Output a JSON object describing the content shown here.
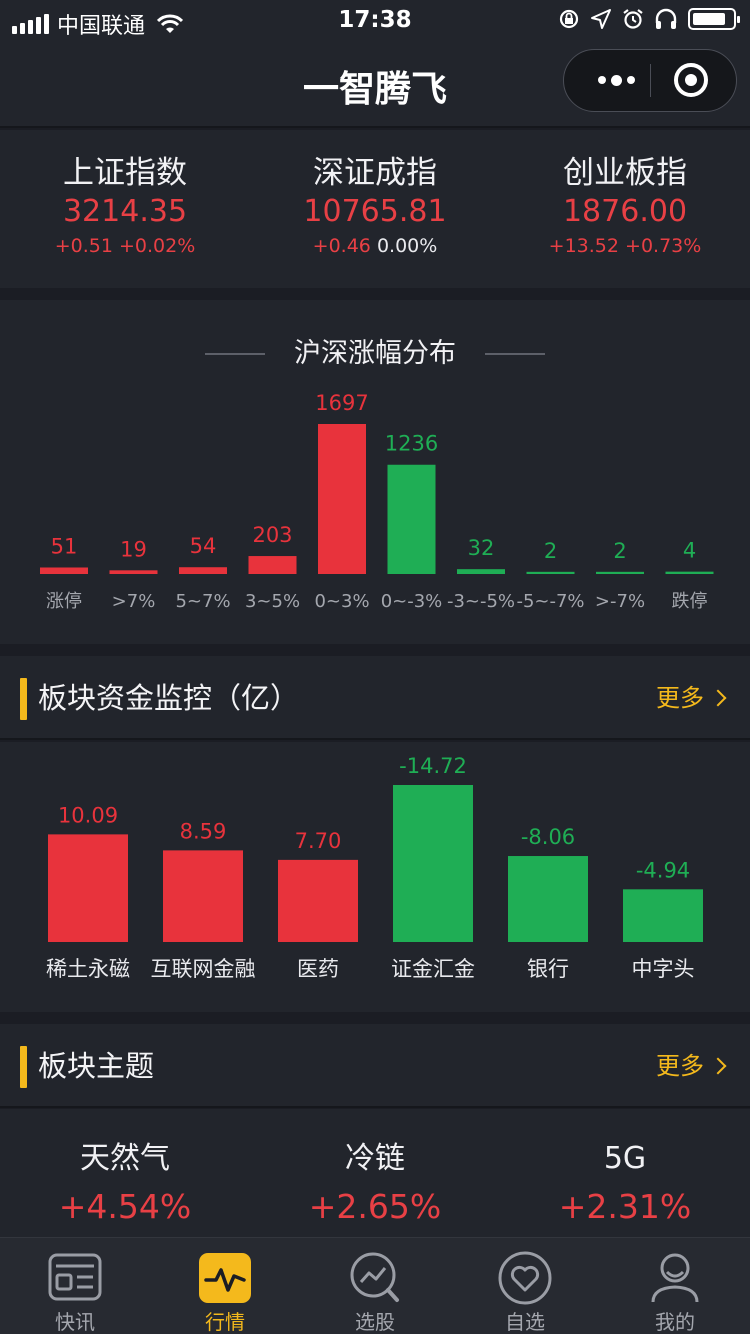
{
  "status_bar": {
    "carrier": "中国联通",
    "time": "17:38",
    "battery_level": 0.85,
    "icons": [
      "signal-icon",
      "wifi-icon",
      "rotation-lock-icon",
      "location-icon",
      "alarm-icon",
      "headphones-icon",
      "battery-icon"
    ]
  },
  "nav": {
    "title": "一智腾飞",
    "more_icon": "more-dots-icon",
    "close_icon": "target-icon"
  },
  "indices": [
    {
      "name": "上证指数",
      "value": "3214.35",
      "change": "+0.51",
      "percent": "+0.02%",
      "change_color": "red",
      "percent_color": "red"
    },
    {
      "name": "深证成指",
      "value": "10765.81",
      "change": "+0.46",
      "percent": "0.00%",
      "change_color": "red",
      "percent_color": "white"
    },
    {
      "name": "创业板指",
      "value": "1876.00",
      "change": "+13.52",
      "percent": "+0.73%",
      "change_color": "red",
      "percent_color": "red"
    }
  ],
  "distribution": {
    "title": "沪深涨幅分布",
    "chart_data": {
      "type": "bar",
      "categories": [
        "涨停",
        ">7%",
        "5~7%",
        "3~5%",
        "0~3%",
        "0~-3%",
        "-3~-5%",
        "-5~-7%",
        ">-7%",
        "跌停"
      ],
      "values": [
        51,
        19,
        54,
        203,
        1697,
        1236,
        32,
        2,
        2,
        4
      ],
      "colors": [
        "#e8333c",
        "#e8333c",
        "#e8333c",
        "#e8333c",
        "#e8333c",
        "#1fae55",
        "#1fae55",
        "#1fae55",
        "#1fae55",
        "#1fae55"
      ],
      "title": "沪深涨幅分布",
      "ylim": [
        0,
        1697
      ]
    }
  },
  "fund_section": {
    "title": "板块资金监控（亿）",
    "more_label": "更多",
    "chart_data": {
      "type": "bar",
      "categories": [
        "稀土永磁",
        "互联网金融",
        "医药",
        "证金汇金",
        "银行",
        "中字头"
      ],
      "values": [
        10.09,
        8.59,
        7.7,
        -14.72,
        -8.06,
        -4.94
      ],
      "labels": [
        "10.09",
        "8.59",
        "7.70",
        "-14.72",
        "-8.06",
        "-4.94"
      ],
      "colors": [
        "#e8333c",
        "#e8333c",
        "#e8333c",
        "#1fae55",
        "#1fae55",
        "#1fae55"
      ],
      "ylim": [
        0,
        14.72
      ]
    }
  },
  "theme_section": {
    "title": "板块主题",
    "more_label": "更多",
    "items": [
      {
        "name": "天然气",
        "change": "+4.54%"
      },
      {
        "name": "冷链",
        "change": "+2.65%"
      },
      {
        "name": "5G",
        "change": "+2.31%"
      }
    ]
  },
  "tabs": [
    {
      "label": "快讯",
      "icon": "news-icon",
      "active": false
    },
    {
      "label": "行情",
      "icon": "market-pulse-icon",
      "active": true
    },
    {
      "label": "选股",
      "icon": "stock-picker-icon",
      "active": false
    },
    {
      "label": "自选",
      "icon": "heart-icon",
      "active": false
    },
    {
      "label": "我的",
      "icon": "profile-icon",
      "active": false
    }
  ],
  "colors": {
    "up": "#e8333c",
    "down": "#1fae55",
    "accent": "#f4b91c",
    "background": "#22252c"
  }
}
